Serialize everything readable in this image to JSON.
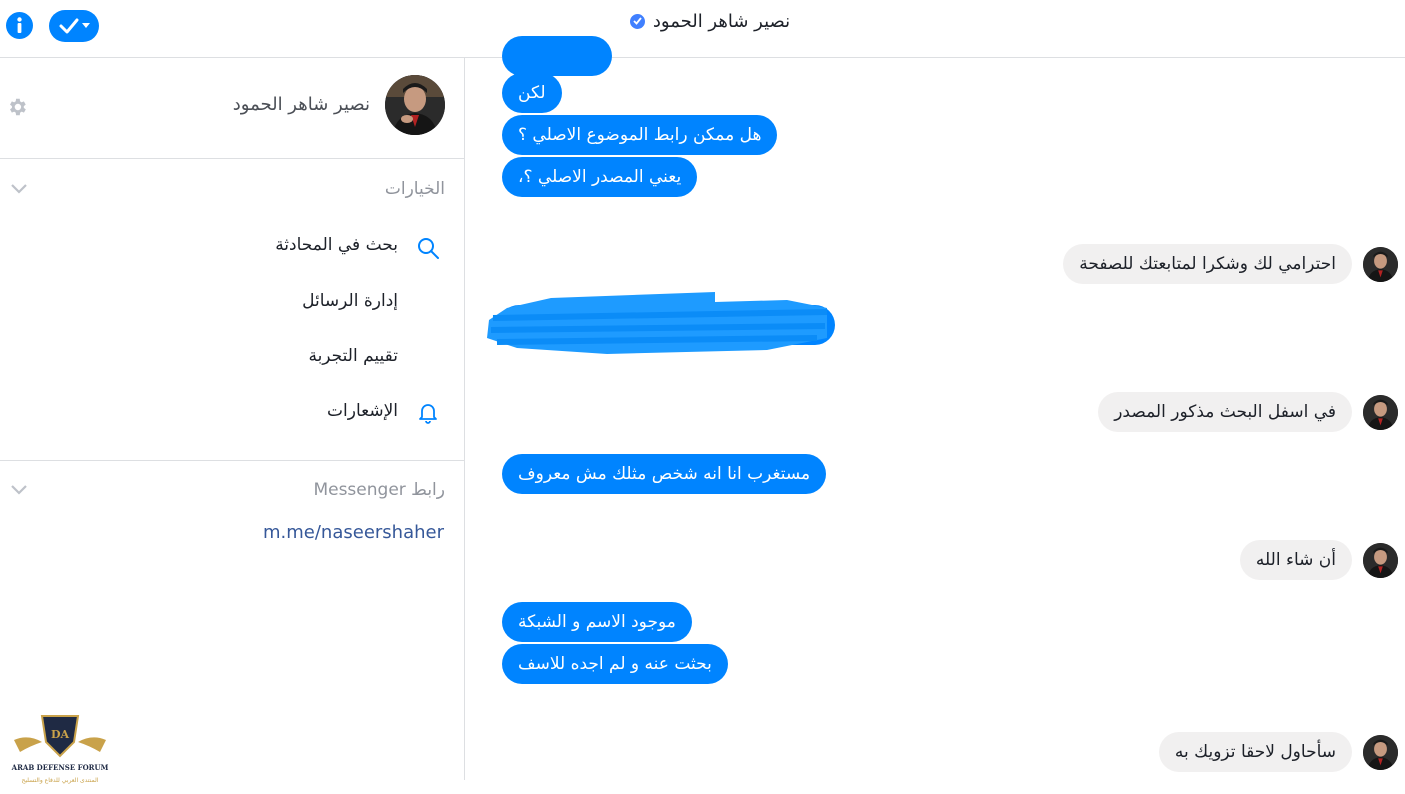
{
  "header": {
    "title": "نصير شاهر الحمود",
    "info_icon": "info-icon",
    "check_icon": "check-dropdown-icon",
    "verified_icon": "verified-badge-icon"
  },
  "sidebar": {
    "profile_name": "نصير شاهر الحمود",
    "options_heading": "الخيارات",
    "options": [
      {
        "label": "بحث في المحادثة",
        "icon": "search-icon"
      },
      {
        "label": "إدارة الرسائل",
        "icon": ""
      },
      {
        "label": "تقييم التجربة",
        "icon": ""
      },
      {
        "label": "الإشعارات",
        "icon": "bell-icon"
      }
    ],
    "messenger_heading": "رابط Messenger",
    "messenger_link": "m.me/naseershaher"
  },
  "logo": {
    "line1": "ARAB DEFENSE FORUM",
    "line2": "المنتدى العربي للدفاع والتسليح",
    "mark": "DA"
  },
  "messages": [
    {
      "text": "لكن",
      "from": "me"
    },
    {
      "text": "هل ممكن رابط الموضوع الاصلي ؟",
      "from": "me"
    },
    {
      "text": "يعني المصدر الاصلي ؟،",
      "from": "me"
    },
    {
      "text": "احترامي لك وشكرا لمتابعتك للصفحة",
      "from": "them"
    },
    {
      "text": "في اسفل البحث مذكور المصدر",
      "from": "them"
    },
    {
      "text": "مستغرب انا انه شخص مثلك مش معروف",
      "from": "me"
    },
    {
      "text": "أن شاء الله",
      "from": "them"
    },
    {
      "text": "موجود الاسم و الشبكة",
      "from": "me"
    },
    {
      "text": "بحثت عنه و لم اجده للاسف",
      "from": "me"
    },
    {
      "text": "سأحاول لاحقا تزويك به",
      "from": "them"
    }
  ],
  "colors": {
    "accent": "#0084ff",
    "incoming_bubble": "#f1f0f0",
    "link": "#365899"
  }
}
